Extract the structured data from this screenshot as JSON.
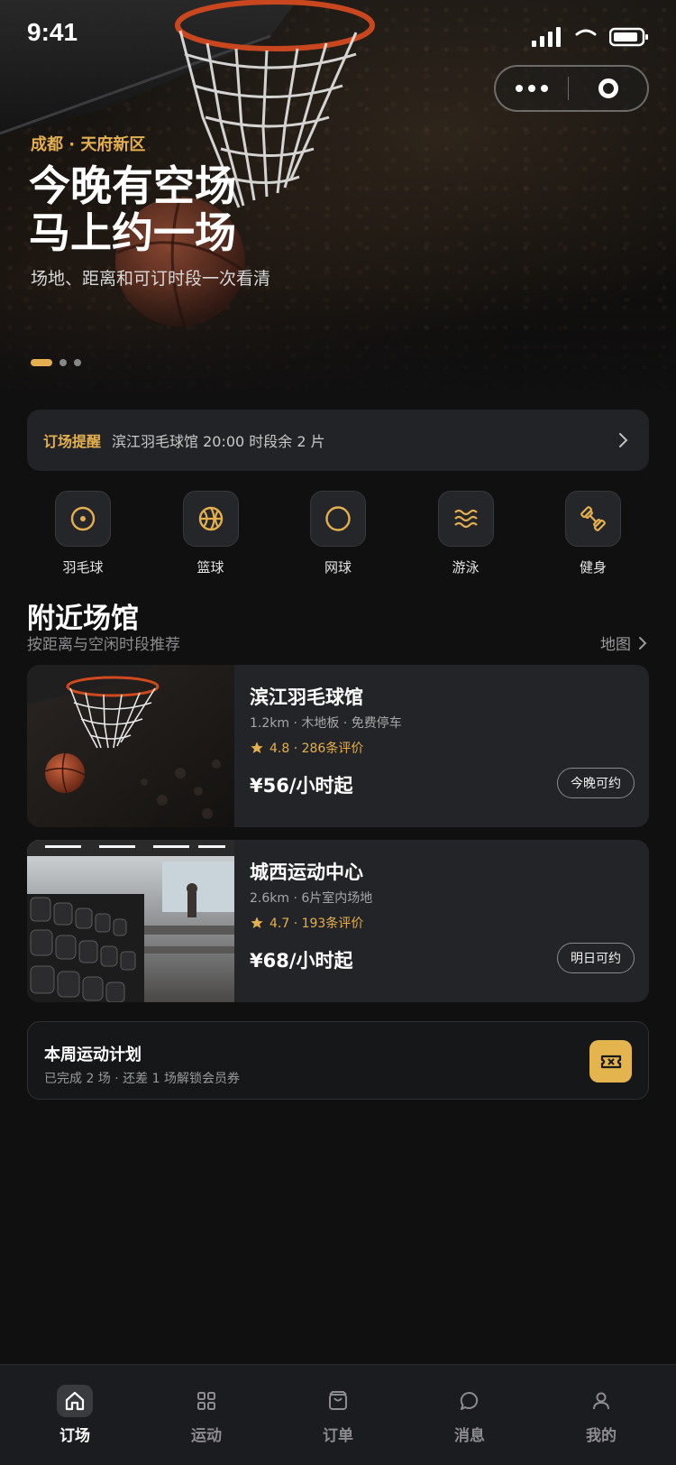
{
  "status": {
    "time": "9:41"
  },
  "hero": {
    "location": "成都 · 天府新区",
    "title_line1": "今晚有空场",
    "title_line2": "马上约一场",
    "subtitle": "场地、距离和可订时段一次看清",
    "slides": 3,
    "active_slide": 0
  },
  "reminder": {
    "tag": "订场提醒",
    "text": "滨江羽毛球馆 20:00 时段余 2 片"
  },
  "categories": [
    {
      "label": "羽毛球",
      "icon": "badminton-icon"
    },
    {
      "label": "篮球",
      "icon": "basketball-icon"
    },
    {
      "label": "网球",
      "icon": "tennis-icon"
    },
    {
      "label": "游泳",
      "icon": "swimming-icon"
    },
    {
      "label": "健身",
      "icon": "dumbbell-icon"
    }
  ],
  "nearby": {
    "title": "附近场馆",
    "subtitle": "按距离与空闲时段推荐",
    "map_label": "地图"
  },
  "venues": [
    {
      "name": "滨江羽毛球馆",
      "meta": "1.2km · 木地板 · 免费停车",
      "rating": "4.8 · 286条评价",
      "price": "¥56/小时起",
      "action": "今晚可约",
      "image": "basketball-hoop-photo"
    },
    {
      "name": "城西运动中心",
      "meta": "2.6km · 6片室内场地",
      "rating": "4.7 · 193条评价",
      "price": "¥68/小时起",
      "action": "明日可约",
      "image": "gym-dumbbell-photo"
    }
  ],
  "plan": {
    "title": "本周运动计划",
    "subtitle": "已完成 2 场 · 还差 1 场解锁会员券",
    "icon": "ticket-icon"
  },
  "tabbar": [
    {
      "label": "订场",
      "icon": "home-icon",
      "active": true
    },
    {
      "label": "运动",
      "icon": "grid-icon",
      "active": false
    },
    {
      "label": "订单",
      "icon": "bag-icon",
      "active": false
    },
    {
      "label": "消息",
      "icon": "chat-icon",
      "active": false
    },
    {
      "label": "我的",
      "icon": "user-icon",
      "active": false
    }
  ],
  "colors": {
    "accent": "#e4b04f",
    "background": "#101011",
    "card": "#232427"
  }
}
